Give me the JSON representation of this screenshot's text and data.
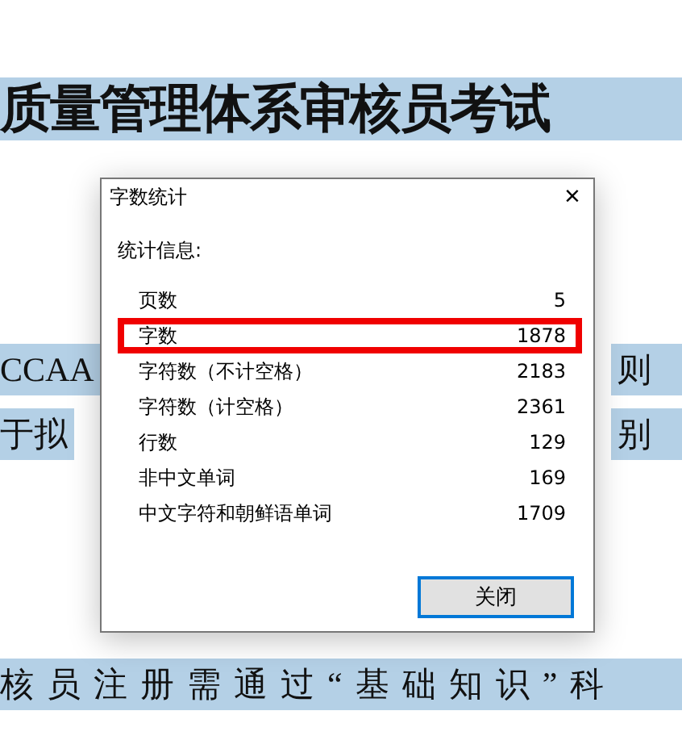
{
  "document": {
    "title": "质量管理体系审核员考试",
    "lines": [
      {
        "left": "CCAA",
        "right": "则"
      },
      {
        "left": "于拟",
        "right": "别"
      },
      {
        "left": "核员注册需通过“基础知识”科"
      }
    ]
  },
  "dialog": {
    "title": "字数统计",
    "close": "×",
    "heading": "统计信息:",
    "rows": [
      {
        "label": "页数",
        "value": "5",
        "highlighted": false
      },
      {
        "label": "字数",
        "value": "1878",
        "highlighted": true
      },
      {
        "label": "字符数（不计空格）",
        "value": "2183",
        "highlighted": false
      },
      {
        "label": "字符数（计空格）",
        "value": "2361",
        "highlighted": false
      },
      {
        "label": "行数",
        "value": "129",
        "highlighted": false
      },
      {
        "label": "非中文单词",
        "value": "169",
        "highlighted": false
      },
      {
        "label": "中文字符和朝鲜语单词",
        "value": "1709",
        "highlighted": false
      }
    ],
    "button": {
      "label": "关闭",
      "focused": true
    }
  }
}
